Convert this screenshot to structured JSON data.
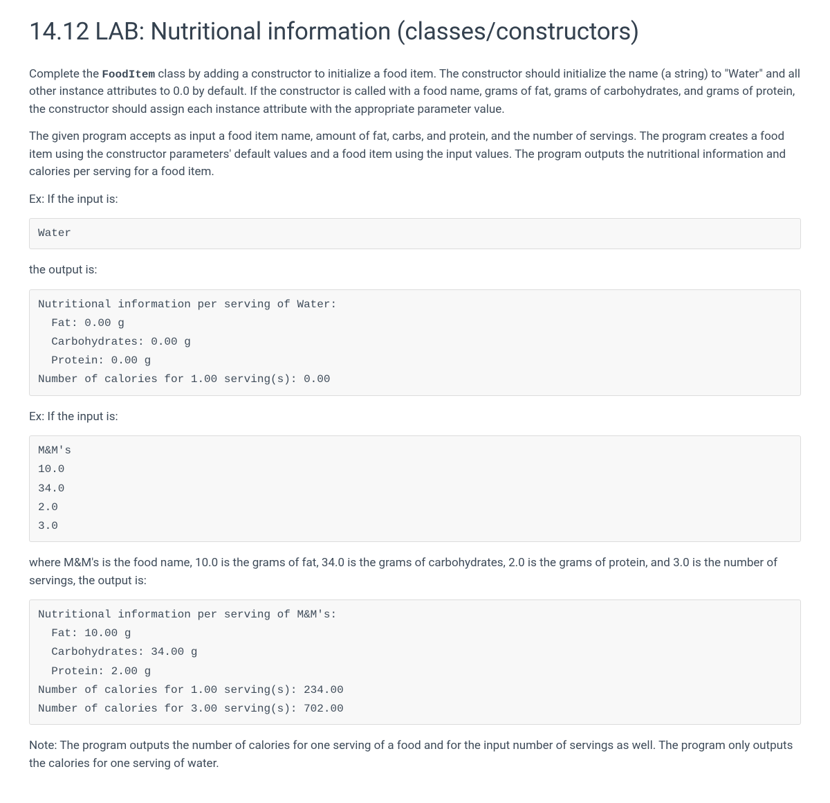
{
  "title": "14.12 LAB: Nutritional information (classes/constructors)",
  "para1_pre": "Complete the ",
  "para1_code": "FoodItem",
  "para1_post": " class by adding a constructor to initialize a food item. The constructor should initialize the name (a string) to \"Water\" and all other instance attributes to 0.0 by default. If the constructor is called with a food name, grams of fat, grams of carbohydrates, and grams of protein, the constructor should assign each instance attribute with the appropriate parameter value.",
  "para2": "The given program accepts as input a food item name, amount of fat, carbs, and protein, and the number of servings. The program creates a food item using the constructor parameters' default values and a food item using the input values. The program outputs the nutritional information and calories per serving for a food item.",
  "ex_if_input": "Ex: If the input is:",
  "input1": "Water",
  "the_output_is": "the output is:",
  "output1": "Nutritional information per serving of Water:\n  Fat: 0.00 g\n  Carbohydrates: 0.00 g\n  Protein: 0.00 g\nNumber of calories for 1.00 serving(s): 0.00",
  "input2": "M&M's\n10.0\n34.0\n2.0\n3.0",
  "para3": "where M&M's is the food name, 10.0 is the grams of fat, 34.0 is the grams of carbohydrates, 2.0 is the grams of protein, and 3.0 is the number of servings, the output is:",
  "output2": "Nutritional information per serving of M&M's:\n  Fat: 10.00 g\n  Carbohydrates: 34.00 g\n  Protein: 2.00 g\nNumber of calories for 1.00 serving(s): 234.00\nNumber of calories for 3.00 serving(s): 702.00",
  "note": "Note: The program outputs the number of calories for one serving of a food and for the input number of servings as well. The program only outputs the calories for one serving of water."
}
